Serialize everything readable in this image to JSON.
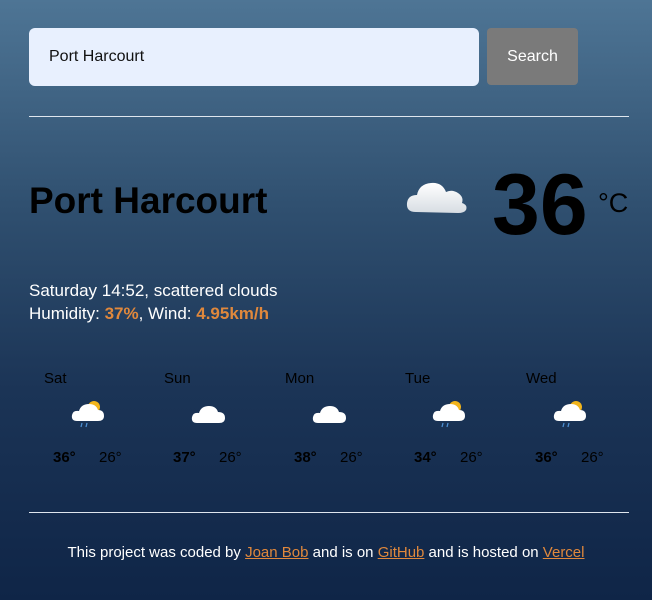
{
  "search": {
    "value": "Port Harcourt",
    "button_label": "Search"
  },
  "current": {
    "city": "Port Harcourt",
    "temperature": "36",
    "unit": "°C",
    "icon": "cloud-icon",
    "datetime_desc": "Saturday 14:52, scattered clouds",
    "humidity_label": "Humidity: ",
    "humidity_value": "37%",
    "wind_label": ", Wind: ",
    "wind_value": "4.95km/h"
  },
  "forecast": [
    {
      "day": "Sat",
      "icon": "rain-sun-icon",
      "max": "36°",
      "min": "26°"
    },
    {
      "day": "Sun",
      "icon": "cloud-icon",
      "max": "37°",
      "min": "26°"
    },
    {
      "day": "Mon",
      "icon": "cloud-icon",
      "max": "38°",
      "min": "26°"
    },
    {
      "day": "Tue",
      "icon": "rain-sun-icon",
      "max": "34°",
      "min": "26°"
    },
    {
      "day": "Wed",
      "icon": "rain-sun-icon",
      "max": "36°",
      "min": "26°"
    }
  ],
  "footer": {
    "text1": "This project was coded by ",
    "author": "Joan Bob",
    "text2": " and is on ",
    "github": "GitHub",
    "text3": " and is hosted on ",
    "host": "Vercel"
  },
  "colors": {
    "accent": "#e0883c",
    "search_button": "#7a7a7a",
    "input_bg": "#e8f0fe"
  }
}
